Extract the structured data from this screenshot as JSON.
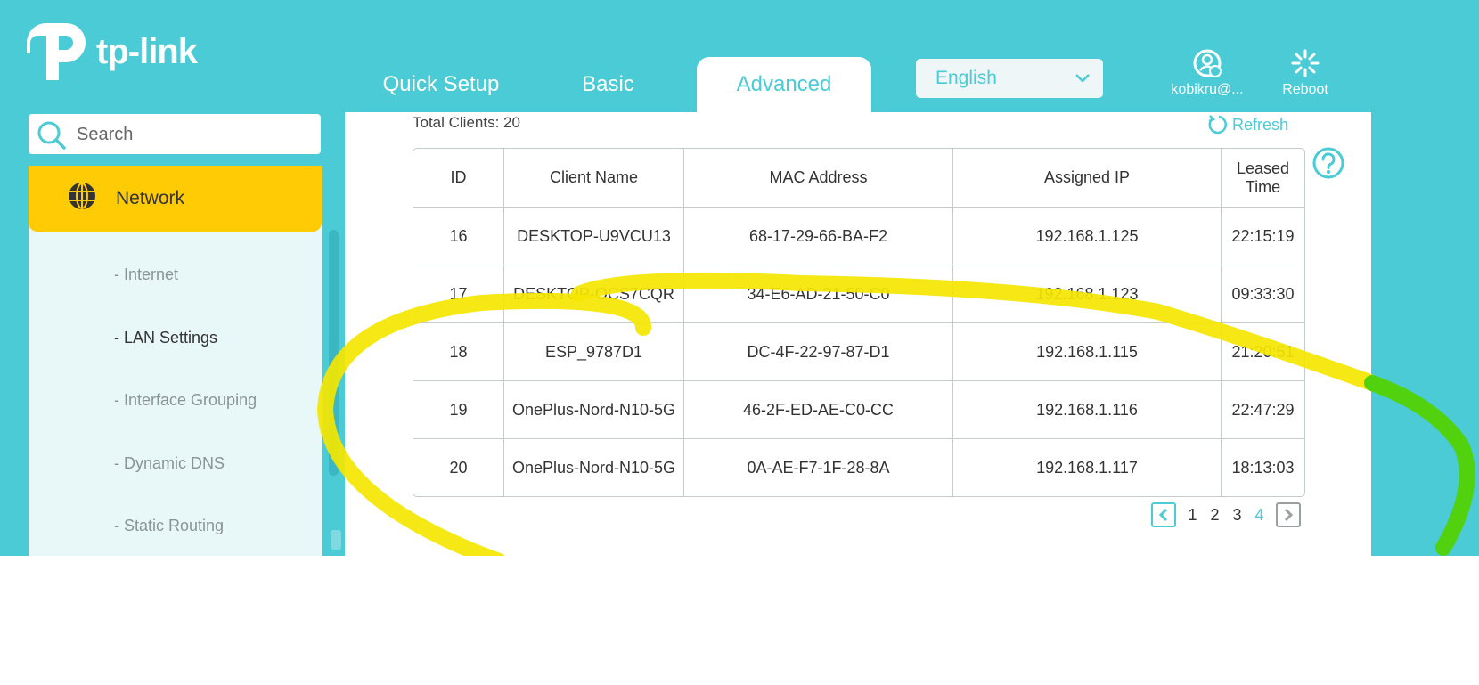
{
  "brand": {
    "logo_text": "tp-link"
  },
  "tabs": [
    {
      "label": "Quick Setup",
      "active": false
    },
    {
      "label": "Basic",
      "active": false
    },
    {
      "label": "Advanced",
      "active": true
    }
  ],
  "language": {
    "selected": "English"
  },
  "account": {
    "label": "kobikru@..."
  },
  "reboot": {
    "label": "Reboot"
  },
  "search": {
    "placeholder": "Search"
  },
  "sidebar": {
    "section": {
      "label": "Network",
      "icon": "globe-icon"
    },
    "items": [
      {
        "label": "- Internet",
        "active": false
      },
      {
        "label": "- LAN Settings",
        "active": true
      },
      {
        "label": "- Interface Grouping",
        "active": false
      },
      {
        "label": "- Dynamic DNS",
        "active": false
      },
      {
        "label": "- Static Routing",
        "active": false
      }
    ]
  },
  "main": {
    "total_clients": "Total Clients: 20",
    "refresh_label": "Refresh",
    "table": {
      "headers": [
        "ID",
        "Client Name",
        "MAC Address",
        "Assigned IP",
        "Leased Time"
      ],
      "rows": [
        [
          "16",
          "DESKTOP-U9VCU13",
          "68-17-29-66-BA-F2",
          "192.168.1.125",
          "22:15:19"
        ],
        [
          "17",
          "DESKTOP-OCS7CQR",
          "34-E6-AD-21-50-C0",
          "192.168.1.123",
          "09:33:30"
        ],
        [
          "18",
          "ESP_9787D1",
          "DC-4F-22-97-87-D1",
          "192.168.1.115",
          "21:20:51"
        ],
        [
          "19",
          "OnePlus-Nord-N10-5G",
          "46-2F-ED-AE-C0-CC",
          "192.168.1.116",
          "22:47:29"
        ],
        [
          "20",
          "OnePlus-Nord-N10-5G",
          "0A-AE-F7-1F-28-8A",
          "192.168.1.117",
          "18:13:03"
        ]
      ]
    },
    "pagination": {
      "pages": [
        "1",
        "2",
        "3",
        "4"
      ],
      "current": "4"
    }
  },
  "colors": {
    "brand": "#4acbd6",
    "accent": "#ffcb05",
    "sidebar_bg": "#e8f7f8",
    "highlight_yellow": "#f4e600",
    "highlight_green": "#52d10f"
  }
}
